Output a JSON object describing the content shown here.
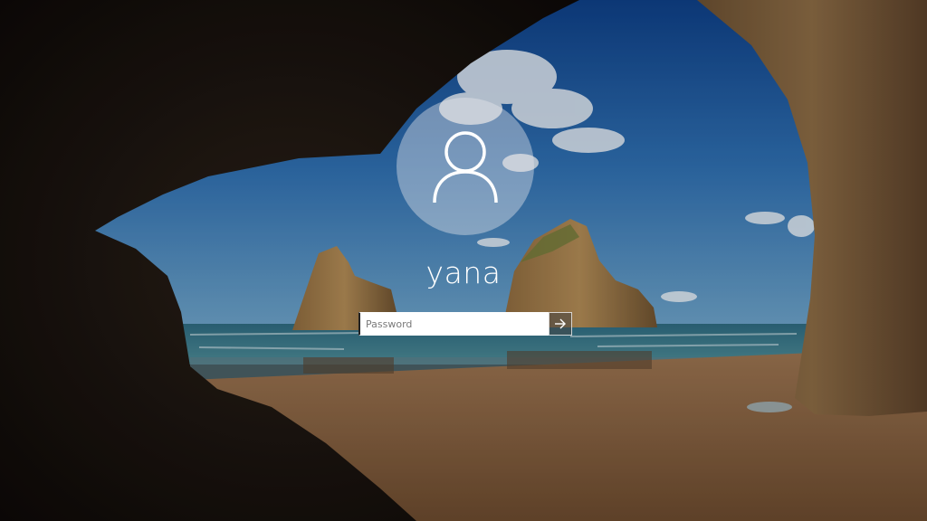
{
  "screen": {
    "type": "windows-lock-screen",
    "wallpaper": "beach-sea-cave",
    "accent_color": "#ffffff"
  },
  "user": {
    "name": "yana",
    "avatar_icon": "user-silhouette-icon"
  },
  "password": {
    "placeholder": "Password",
    "value": "",
    "submit_icon": "arrow-right-icon"
  }
}
